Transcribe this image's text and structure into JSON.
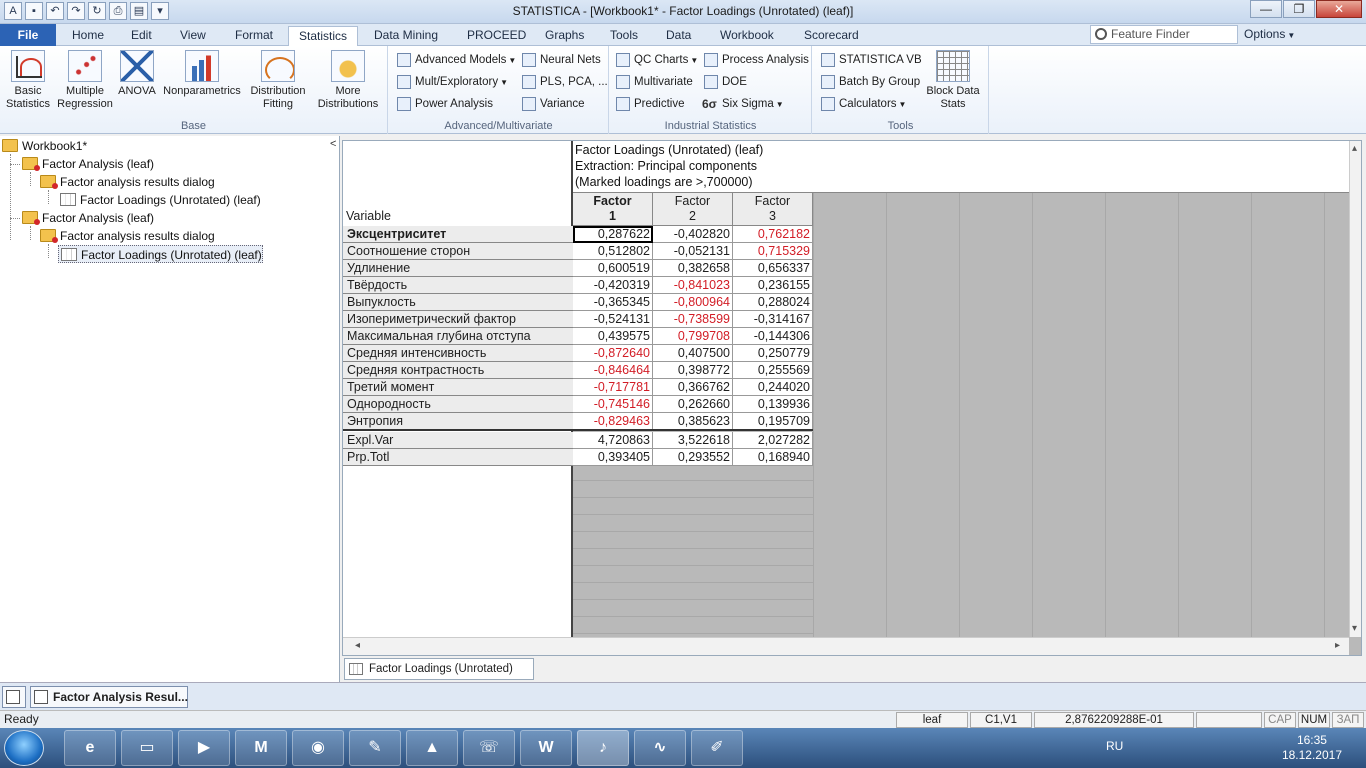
{
  "window": {
    "title": "STATISTICA - [Workbook1* - Factor Loadings (Unrotated) (leaf)]",
    "qat_icons": [
      "app-icon",
      "save-icon",
      "undo-icon",
      "redo-icon",
      "refresh-icon",
      "print-icon",
      "clipboard-icon",
      "customize-icon"
    ],
    "controls": {
      "minimize": "—",
      "restore": "❐",
      "close": "✕"
    }
  },
  "ribbon": {
    "tabs": [
      "File",
      "Home",
      "Edit",
      "View",
      "Format",
      "Statistics",
      "Data Mining",
      "PROCEED",
      "Graphs",
      "Tools",
      "Data",
      "Workbook",
      "Scorecard"
    ],
    "active_tab": "Statistics",
    "feature_finder_placeholder": "Feature Finder",
    "options_label": "Options",
    "groups": {
      "base": {
        "label": "Base",
        "buttons": [
          {
            "label": "Basic\nStatistics"
          },
          {
            "label": "Multiple\nRegression"
          },
          {
            "label": "ANOVA"
          },
          {
            "label": "Nonparametrics"
          },
          {
            "label": "Distribution\nFitting"
          },
          {
            "label": "More\nDistributions"
          }
        ]
      },
      "advanced": {
        "label": "Advanced/Multivariate",
        "buttons": [
          "Advanced Models",
          "Neural Nets",
          "Mult/Exploratory",
          "PLS, PCA, ...",
          "Power Analysis",
          "Variance"
        ]
      },
      "industrial": {
        "label": "Industrial Statistics",
        "buttons": [
          "QC Charts",
          "Process Analysis",
          "Multivariate",
          "DOE",
          "Predictive",
          "Six Sigma"
        ],
        "six_sigma_glyph": "6σ"
      },
      "tools": {
        "label": "Tools",
        "buttons": [
          "STATISTICA VB",
          "Batch By Group",
          "Calculators"
        ],
        "block": "Block Data\nStats"
      }
    }
  },
  "tree": {
    "root": "Workbook1*",
    "items": [
      {
        "label": "Factor Analysis (leaf)"
      },
      {
        "label": "Factor analysis results dialog"
      },
      {
        "label": "Factor Loadings (Unrotated) (leaf)"
      },
      {
        "label": "Factor Analysis (leaf)"
      },
      {
        "label": "Factor analysis results dialog"
      },
      {
        "label": "Factor Loadings (Unrotated) (leaf)"
      }
    ]
  },
  "spreadsheet": {
    "header_lines": [
      "Factor Loadings (Unrotated) (leaf)",
      "Extraction: Principal components",
      "(Marked loadings are >,700000)"
    ],
    "variable_label": "Variable",
    "columns": [
      {
        "line1": "Factor",
        "line2": "1"
      },
      {
        "line1": "Factor",
        "line2": "2"
      },
      {
        "line1": "Factor",
        "line2": "3"
      }
    ],
    "rows": [
      {
        "label": "Эксцентриситет",
        "values": [
          "0,287622",
          "-0,402820",
          "0,762182"
        ],
        "marked": [
          false,
          false,
          true
        ]
      },
      {
        "label": "Соотношение сторон",
        "values": [
          "0,512802",
          "-0,052131",
          "0,715329"
        ],
        "marked": [
          false,
          false,
          true
        ]
      },
      {
        "label": "Удлинение",
        "values": [
          "0,600519",
          "0,382658",
          "0,656337"
        ],
        "marked": [
          false,
          false,
          false
        ]
      },
      {
        "label": "Твёрдость",
        "values": [
          "-0,420319",
          "-0,841023",
          "0,236155"
        ],
        "marked": [
          false,
          true,
          false
        ]
      },
      {
        "label": "Выпуклость",
        "values": [
          "-0,365345",
          "-0,800964",
          "0,288024"
        ],
        "marked": [
          false,
          true,
          false
        ]
      },
      {
        "label": "Изопериметрический фактор",
        "values": [
          "-0,524131",
          "-0,738599",
          "-0,314167"
        ],
        "marked": [
          false,
          true,
          false
        ]
      },
      {
        "label": "Максимальная глубина отступа",
        "values": [
          "0,439575",
          "0,799708",
          "-0,144306"
        ],
        "marked": [
          false,
          true,
          false
        ]
      },
      {
        "label": "Средняя интенсивность",
        "values": [
          "-0,872640",
          "0,407500",
          "0,250779"
        ],
        "marked": [
          true,
          false,
          false
        ]
      },
      {
        "label": "Средняя контрастность",
        "values": [
          "-0,846464",
          "0,398772",
          "0,255569"
        ],
        "marked": [
          true,
          false,
          false
        ]
      },
      {
        "label": "Третий момент",
        "values": [
          "-0,717781",
          "0,366762",
          "0,244020"
        ],
        "marked": [
          true,
          false,
          false
        ]
      },
      {
        "label": "Однородность",
        "values": [
          "-0,745146",
          "0,262660",
          "0,139936"
        ],
        "marked": [
          true,
          false,
          false
        ]
      },
      {
        "label": "Энтропия",
        "values": [
          "-0,829463",
          "0,385623",
          "0,195709"
        ],
        "marked": [
          true,
          false,
          false
        ]
      }
    ],
    "summary_rows": [
      {
        "label": "Expl.Var",
        "values": [
          "4,720863",
          "3,522618",
          "2,027282"
        ]
      },
      {
        "label": "Prp.Totl",
        "values": [
          "0,393405",
          "0,293552",
          "0,168940"
        ]
      }
    ],
    "marked_color": "#d21d26",
    "sheet_tab": "Factor Loadings (Unrotated) (leaf)"
  },
  "window_strip": {
    "button": "Factor Analysis Resul..."
  },
  "statusbar": {
    "ready": "Ready",
    "leaf": "leaf",
    "cell": "C1,V1",
    "value": "2,8762209288E-01",
    "cap": "CAP",
    "num": "NUM",
    "zap": "ЗАП"
  },
  "taskbar": {
    "apps": [
      "ie-icon",
      "explorer-icon",
      "media-player-icon",
      "mathcad-icon",
      "chrome-icon",
      "app-icon",
      "matlab-icon",
      "viber-icon",
      "word-icon",
      "statistica-icon",
      "graph-icon",
      "notepad-icon"
    ],
    "app_glyphs": [
      "e",
      "▭",
      "▶",
      "M",
      "◉",
      "✎",
      "▲",
      "☏",
      "W",
      "♪",
      "∿",
      "✐"
    ],
    "lang": "RU",
    "time": "16:35",
    "date": "18.12.2017"
  }
}
